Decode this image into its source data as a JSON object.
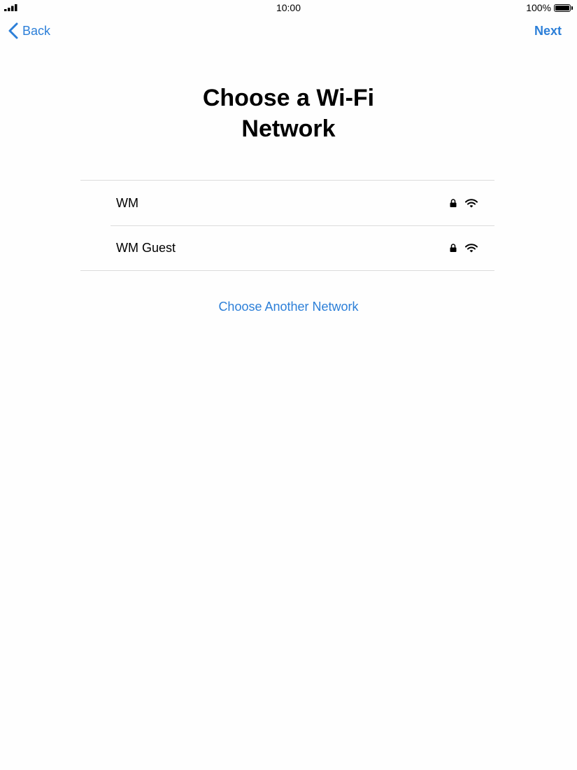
{
  "status_bar": {
    "time": "10:00",
    "battery_percent": "100%",
    "icons": [
      "signal-icon",
      "battery-icon"
    ]
  },
  "nav": {
    "back_label": "Back",
    "next_label": "Next",
    "back_icon": "chevron-left-icon"
  },
  "page": {
    "title": "Choose a Wi-Fi\nNetwork"
  },
  "networks": [
    {
      "name": "WM",
      "secured": true,
      "signal_icon": "wifi-icon"
    },
    {
      "name": "WM Guest",
      "secured": true,
      "signal_icon": "wifi-icon"
    }
  ],
  "other_network_label": "Choose Another Network",
  "colors": {
    "accent": "#2c7fd8",
    "divider": "#dcdcdc",
    "background": "#fefefe"
  }
}
